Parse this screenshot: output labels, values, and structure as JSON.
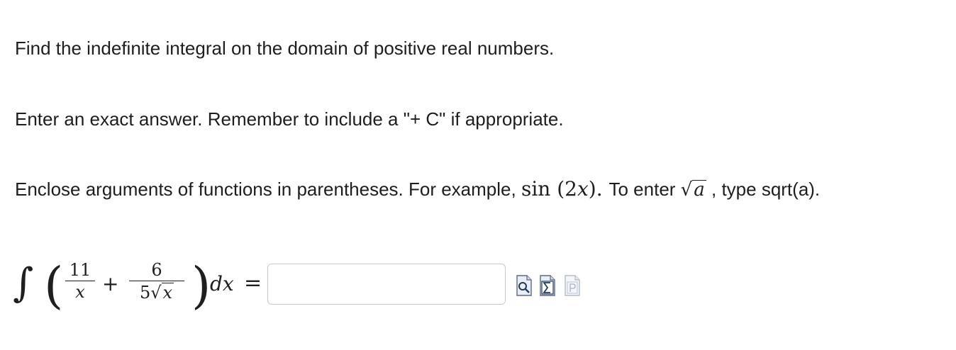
{
  "instructions": {
    "line1": "Find the indefinite integral on the domain of positive real numbers.",
    "line2": "Enter an exact answer. Remember to include a \"+ C\" if appropriate.",
    "line3_before": "Enclose arguments of functions in parentheses. For example,",
    "line3_example_fn": "sin",
    "line3_example_arg": "(2",
    "line3_example_var": "x",
    "line3_example_close": ").",
    "line3_mid": " To enter ",
    "line3_sqrt_var": "a",
    "line3_after": ", type sqrt(a)."
  },
  "problem": {
    "integral_sign": "∫",
    "paren_open": "(",
    "paren_close": ")",
    "term1_numerator": "11",
    "term1_denominator": "x",
    "plus": "+",
    "term2_numerator": "6",
    "term2_denominator_coef": "5",
    "term2_denominator_var": "x",
    "differential": "dx",
    "equals": "="
  },
  "answer": {
    "value": "",
    "placeholder": ""
  },
  "toolbar": {
    "icons": [
      "preview-icon",
      "equation-editor-icon",
      "ptx-icon"
    ]
  }
}
